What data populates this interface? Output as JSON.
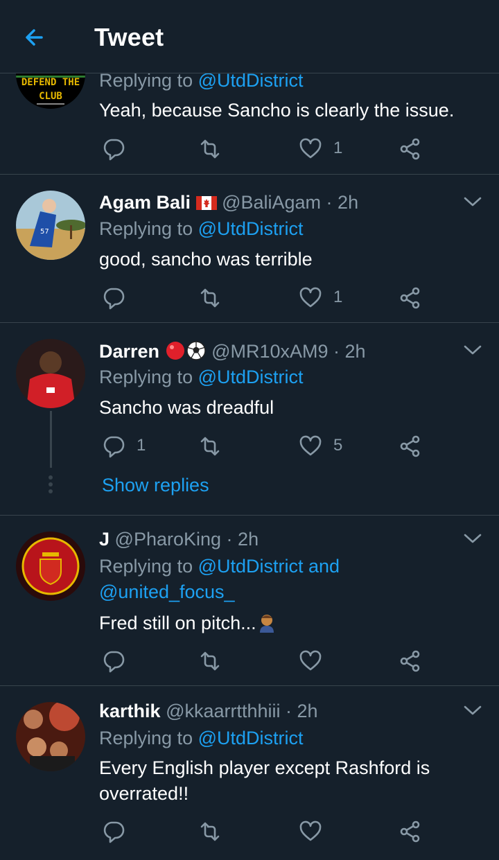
{
  "header": {
    "title": "Tweet",
    "back_icon": "arrow-left-icon"
  },
  "colors": {
    "background": "#15202b",
    "accent": "#1da1f2",
    "muted": "#8899a6",
    "divider": "#38444d"
  },
  "tweets": [
    {
      "avatar_text": [
        "DEFEND THE",
        "CLUB"
      ],
      "replying_prefix": "Replying to ",
      "replying_to": "@UtdDistrict",
      "text": "Yeah, because Sancho is clearly the issue.",
      "reply_count": "",
      "retweet_count": "",
      "like_count": "1"
    },
    {
      "name": "Agam Bali",
      "name_flag": "canada-flag",
      "handle": "@BaliAgam",
      "time": "2h",
      "replying_prefix": "Replying to ",
      "replying_to": "@UtdDistrict",
      "text": "good, sancho was terrible",
      "reply_count": "",
      "like_count": "1"
    },
    {
      "name": "Darren",
      "name_emoji": [
        "red-circle",
        "soccer-ball"
      ],
      "handle": "@MR10xAM9",
      "time": "2h",
      "replying_prefix": "Replying to ",
      "replying_to": "@UtdDistrict",
      "text": "Sancho was dreadful",
      "reply_count": "1",
      "like_count": "5",
      "show_replies": "Show replies"
    },
    {
      "name": "J",
      "handle": "@PharoKing",
      "time": "2h",
      "replying_prefix": "Replying to ",
      "replying_to": "@UtdDistrict and",
      "replying_to_2": "@united_focus_",
      "text": "Fred still on pitch...",
      "text_emoji": "person-facepalming",
      "reply_count": "",
      "like_count": ""
    },
    {
      "name": "karthik",
      "handle": "@kkaarrtthhiii",
      "time": "2h",
      "replying_prefix": "Replying to ",
      "replying_to": "@UtdDistrict",
      "text_line1": "Every English player except Rashford is",
      "text_line2": "overrated!!",
      "reply_count": "",
      "like_count": ""
    }
  ],
  "separator": " · "
}
